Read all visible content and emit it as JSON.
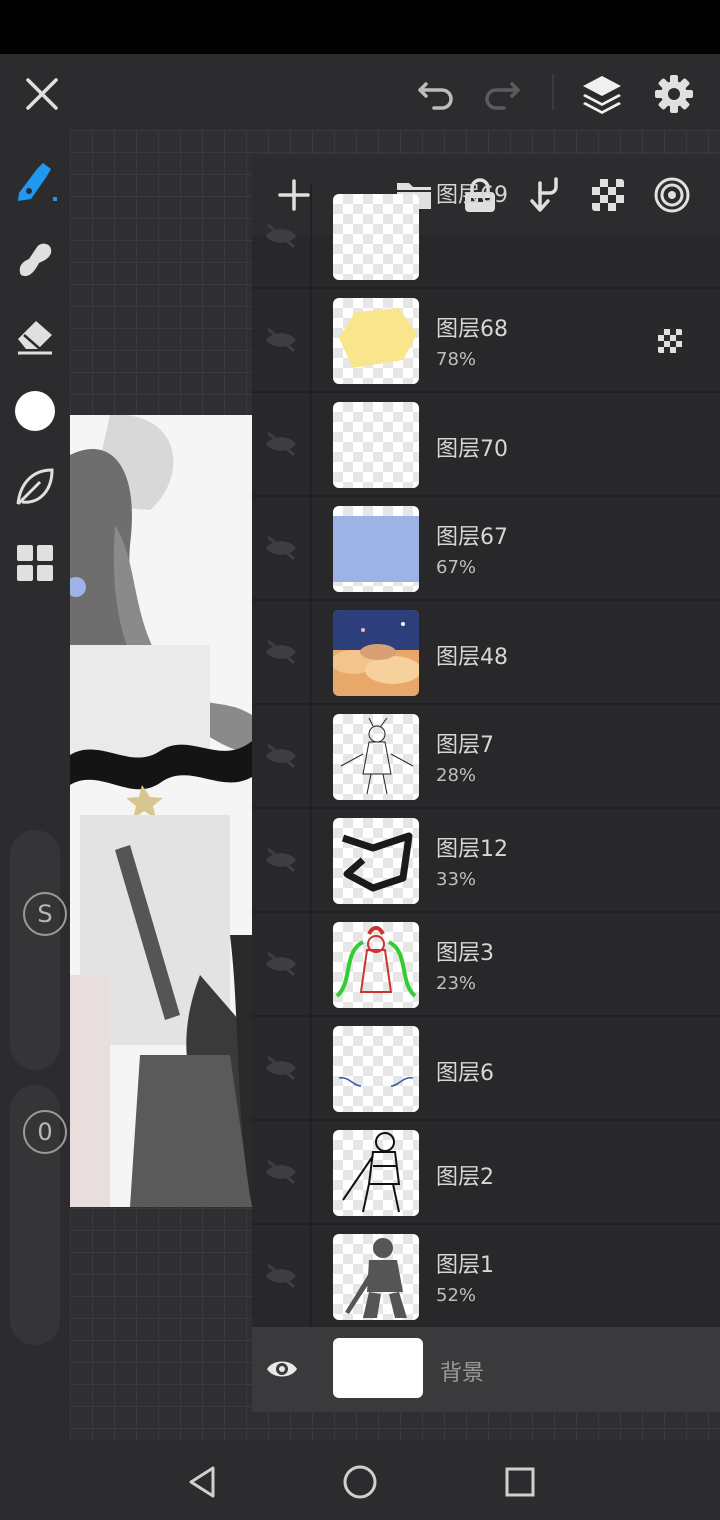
{
  "toolbar": {
    "close": "close-icon",
    "undo": "undo-icon",
    "redo": "redo-icon",
    "layers": "layers-icon",
    "settings": "gear-icon"
  },
  "tools": [
    "pen-icon",
    "smudge-icon",
    "eraser-icon",
    "color-icon",
    "leaf-icon",
    "grid-icon"
  ],
  "sliders": {
    "size_label": "S",
    "opacity_label": "0"
  },
  "layers_panel": {
    "actions": [
      "add-icon",
      "folder-icon",
      "lock-icon",
      "merge-down-icon",
      "transparency-icon",
      "target-icon"
    ],
    "layers": [
      {
        "name": "图层69",
        "opacity": ""
      },
      {
        "name": "图层68",
        "opacity": "78%",
        "alpha_lock": true
      },
      {
        "name": "图层70",
        "opacity": ""
      },
      {
        "name": "图层67",
        "opacity": "67%"
      },
      {
        "name": "图层48",
        "opacity": ""
      },
      {
        "name": "图层7",
        "opacity": "28%"
      },
      {
        "name": "图层12",
        "opacity": "33%"
      },
      {
        "name": "图层3",
        "opacity": "23%"
      },
      {
        "name": "图层6",
        "opacity": ""
      },
      {
        "name": "图层2",
        "opacity": ""
      },
      {
        "name": "图层1",
        "opacity": "52%"
      }
    ],
    "background": {
      "name": "背景",
      "visible": true
    }
  },
  "nav": {
    "back": "back-icon",
    "home": "home-icon",
    "recents": "recents-icon"
  },
  "colors": {
    "accent": "#1e9bf0",
    "panel": "#2c2c2e"
  }
}
